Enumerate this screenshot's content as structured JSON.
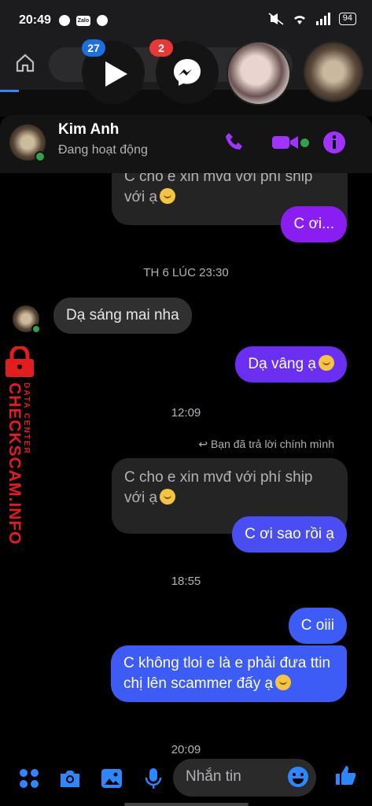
{
  "status_bar": {
    "time": "20:49",
    "battery": "94"
  },
  "chat_heads": [
    {
      "badge": "27"
    },
    {
      "badge": "2"
    }
  ],
  "header": {
    "name": "Kim Anh",
    "status": "Đang hoạt động"
  },
  "messages": [
    {
      "text": "C cho e xin mvđ với phí ship với ạ",
      "emoji": "crying-face"
    },
    {
      "text": "C ơi..."
    },
    {
      "time": "TH 6 LÚC 23:30"
    },
    {
      "text": "Dạ sáng mai nha"
    },
    {
      "text": "Dạ vâng ạ",
      "emoji": "pleading-face"
    },
    {
      "time": "12:09"
    },
    {
      "reply_note": "Bạn đã trả lời chính mình"
    },
    {
      "text": "C cho e xin mvđ với phí ship với ạ",
      "emoji": "crying-face"
    },
    {
      "text": "C ơi sao rồi ạ"
    },
    {
      "time": "18:55"
    },
    {
      "text": "C oiii"
    },
    {
      "text": "C không tloi e là e phải đưa ttin chị lên scammer đấy ạ",
      "emoji": "pleading-face"
    },
    {
      "time": "20:09"
    }
  ],
  "composer": {
    "placeholder": "Nhắn tin"
  },
  "watermark": {
    "main": "CHECKSCAM.INFO",
    "sub": "DATA CENTER"
  },
  "colors": {
    "purple": "#8a1ef2",
    "blue": "#3d5bf5",
    "online": "#31a24c",
    "watermark": "#e11d1d"
  }
}
